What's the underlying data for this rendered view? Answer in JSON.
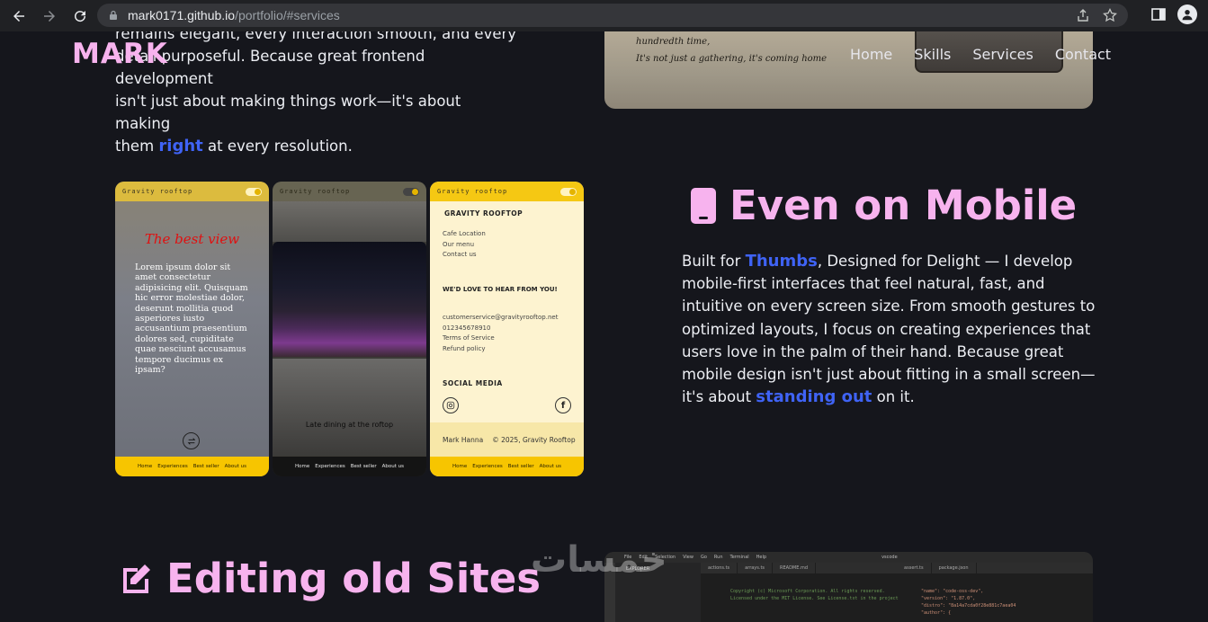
{
  "browser": {
    "url_host": "mark0171.github.io",
    "url_path": "/portfolio/#services"
  },
  "site": {
    "brand": "MARK",
    "nav": [
      "Home",
      "Skills",
      "Services",
      "Contact"
    ]
  },
  "section_desktop": {
    "para_line1": "remains elegant, every interaction smooth, and every",
    "para_line2": "detail purposeful. Because great frontend development",
    "para_line3": "isn't just about making things work—it's about making",
    "para_pre": "them ",
    "para_hl": "right",
    "para_post": " at every resolution.",
    "photo_line1": "hundredth time,",
    "photo_line2": "It's not just a gathering, it's coming home"
  },
  "section_mobile": {
    "title": "Even on Mobile",
    "p_pre": "Built for ",
    "p_hl1": "Thumbs",
    "p_mid": ", Designed for Delight — I develop mobile-first interfaces that feel natural, fast, and intuitive on every screen size. From smooth gestures to optimized layouts, I focus on creating experiences that users love in the palm of their hand. Because great mobile design isn't just about fitting in a small screen—it's about ",
    "p_hl2": "standing out",
    "p_post": " on it."
  },
  "phones": {
    "app_name": "Gravity rooftop",
    "footer_links": [
      "Home",
      "Experiences",
      "Best seller",
      "About us"
    ],
    "phone1": {
      "title": "The best view",
      "lorem": "Lorem ipsum dolor sit amet consectetur adipisicing elit. Quisquam hic error molestiae dolor, deserunt mollitia quod asperiores iusto accusantium praesentium dolores sed, cupiditate quae nesciunt accusamus tempore ducimus ex ipsam?"
    },
    "phone2": {
      "caption": "Late dining at the roftop"
    },
    "phone3": {
      "heading": "GRAVITY ROOFTOP",
      "links": [
        "Cafe Location",
        "Our menu",
        "Contact us"
      ],
      "hear": "WE'D LOVE TO HEAR FROM YOU!",
      "contact": [
        "customerservice@gravityrooftop.net",
        "012345678910",
        "Terms of Service",
        "Refund policy"
      ],
      "social": "SOCIAL MEDIA",
      "fb": "f",
      "author": "Mark Hanna",
      "copyright": "© 2025, Gravity Rooftop"
    }
  },
  "section_editing": {
    "title": "Editing old Sites"
  },
  "vscode": {
    "menu": [
      "File",
      "Edit",
      "Selection",
      "View",
      "Go",
      "Run",
      "Terminal",
      "Help"
    ],
    "search": "vscode",
    "explorer": "EXPLORER",
    "tabs": [
      "actions.ts",
      "arrays.ts",
      "README.md",
      "assert.ts",
      "package.json"
    ],
    "code_left": [
      "Copyright (c) Microsoft Corporation. All rights reserved.",
      "Licensed under the MIT License. See License.txt in the project"
    ],
    "code_right": [
      "\"name\": \"code-oss-dev\",",
      "\"version\": \"1.87.0\",",
      "\"distro\": \"8a14a7cda0f28e881c7aea04",
      "\"author\": {"
    ]
  },
  "watermark": "خمسات"
}
